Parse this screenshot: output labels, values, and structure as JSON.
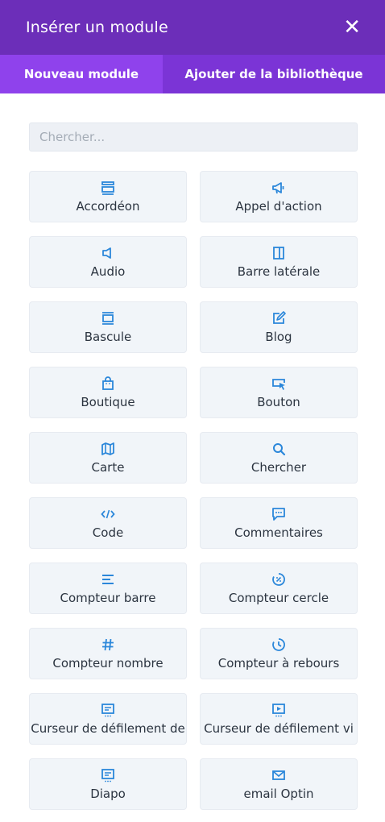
{
  "header": {
    "title": "Insérer un module"
  },
  "tabs": [
    "Nouveau module",
    "Ajouter de la bibliothèque"
  ],
  "search": {
    "placeholder": "Chercher...",
    "value": ""
  },
  "colors": {
    "header": "#6c2eb9",
    "tab_active": "#8f42ec",
    "tab_inactive": "#7b34d6",
    "icon": "#2b87da"
  },
  "modules": [
    {
      "label": "Accordéon",
      "icon": "accordion-icon"
    },
    {
      "label": "Appel d'action",
      "icon": "megaphone-icon"
    },
    {
      "label": "Audio",
      "icon": "speaker-icon"
    },
    {
      "label": "Barre latérale",
      "icon": "sidebar-icon"
    },
    {
      "label": "Bascule",
      "icon": "toggle-icon"
    },
    {
      "label": "Blog",
      "icon": "blog-icon"
    },
    {
      "label": "Boutique",
      "icon": "shopping-bag-icon"
    },
    {
      "label": "Bouton",
      "icon": "button-cursor-icon"
    },
    {
      "label": "Carte",
      "icon": "map-icon"
    },
    {
      "label": "Chercher",
      "icon": "search-icon"
    },
    {
      "label": "Code",
      "icon": "code-icon"
    },
    {
      "label": "Commentaires",
      "icon": "comments-icon"
    },
    {
      "label": "Compteur barre",
      "icon": "bar-counter-icon"
    },
    {
      "label": "Compteur cercle",
      "icon": "circle-counter-icon"
    },
    {
      "label": "Compteur nombre",
      "icon": "hash-icon"
    },
    {
      "label": "Compteur à rebours",
      "icon": "clock-icon"
    },
    {
      "label": "Curseur de défilement de",
      "icon": "slider-icon"
    },
    {
      "label": "Curseur de défilement vi",
      "icon": "video-slider-icon"
    },
    {
      "label": "Diapo",
      "icon": "slide-icon"
    },
    {
      "label": "email Optin",
      "icon": "envelope-icon"
    }
  ]
}
